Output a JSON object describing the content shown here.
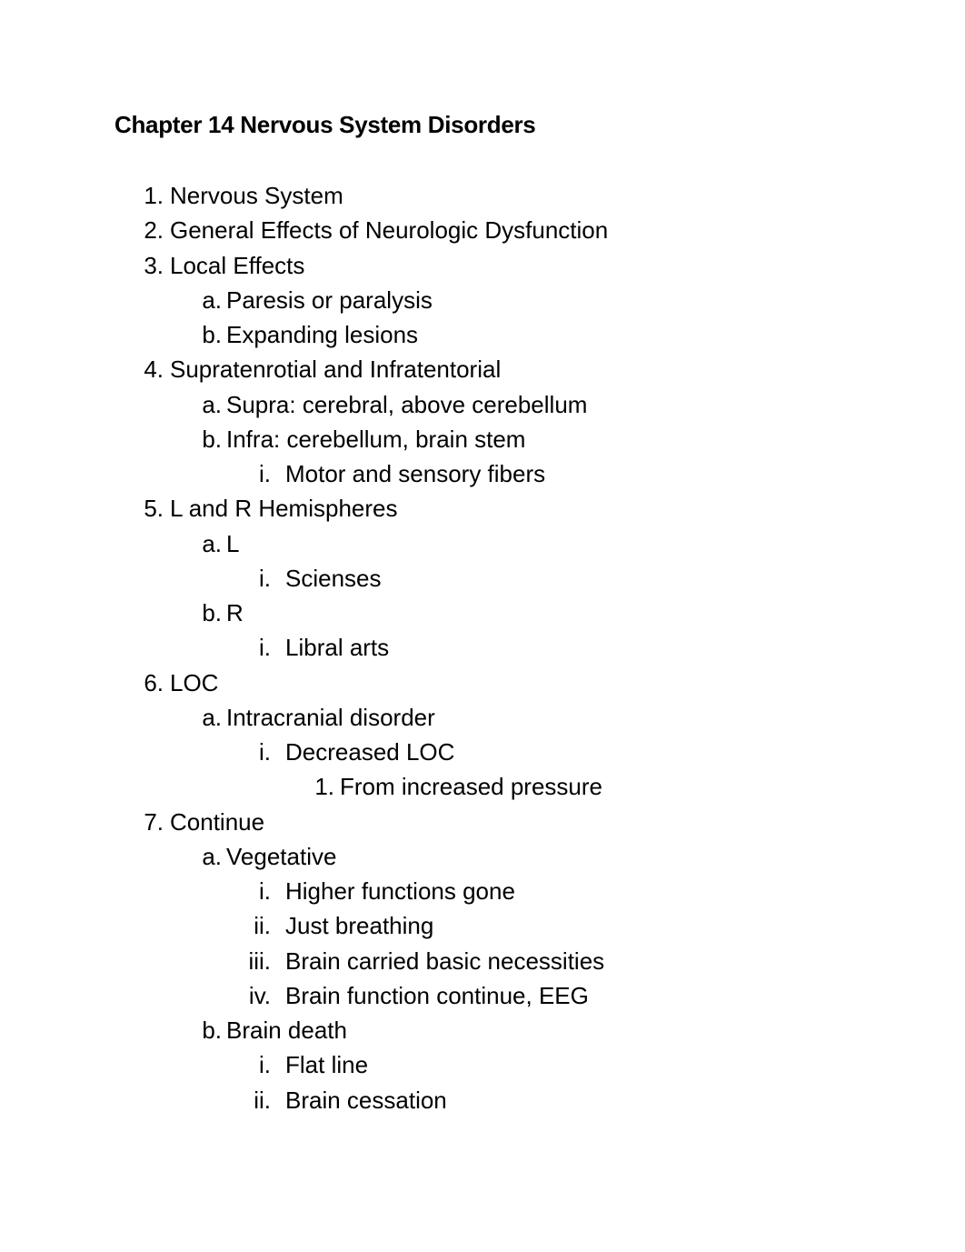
{
  "document": {
    "title": "Chapter 14 Nervous System Disorders",
    "outline": [
      {
        "level": 1,
        "marker": "1.",
        "text": "Nervous System"
      },
      {
        "level": 1,
        "marker": "2.",
        "text": "General Effects of Neurologic Dysfunction"
      },
      {
        "level": 1,
        "marker": "3.",
        "text": "Local Effects"
      },
      {
        "level": 2,
        "marker": "a.",
        "text": "Paresis or paralysis"
      },
      {
        "level": 2,
        "marker": "b.",
        "text": "Expanding lesions"
      },
      {
        "level": 1,
        "marker": "4.",
        "text": "Supratenrotial and Infratentorial"
      },
      {
        "level": 2,
        "marker": "a.",
        "text": "Supra: cerebral, above cerebellum"
      },
      {
        "level": 2,
        "marker": "b.",
        "text": "Infra: cerebellum, brain stem"
      },
      {
        "level": 3,
        "marker": "i.",
        "text": "Motor and sensory fibers"
      },
      {
        "level": 1,
        "marker": "5.",
        "text": "L and R Hemispheres"
      },
      {
        "level": 2,
        "marker": "a.",
        "text": "L"
      },
      {
        "level": 3,
        "marker": "i.",
        "text": "Sciense s"
      },
      {
        "level": 2,
        "marker": "b.",
        "text": "R"
      },
      {
        "level": 3,
        "marker": "i.",
        "text": "Libral arts"
      },
      {
        "level": 1,
        "marker": "6.",
        "text": "LOC"
      },
      {
        "level": 2,
        "marker": "a.",
        "text": "Intracranial disorder"
      },
      {
        "level": 3,
        "marker": "i.",
        "text": "Decreased LOC"
      },
      {
        "level": 4,
        "marker": "1.",
        "text": "From increased pressure"
      },
      {
        "level": 1,
        "marker": "7.",
        "text": "Continue"
      },
      {
        "level": 2,
        "marker": "a.",
        "text": "Vegetative"
      },
      {
        "level": 3,
        "marker": "i.",
        "text": "Higher functions gone"
      },
      {
        "level": 3,
        "marker": "ii.",
        "text": "Just breathing"
      },
      {
        "level": 3,
        "marker": "iii.",
        "text": "Brain carried basic necessities"
      },
      {
        "level": 3,
        "marker": "iv.",
        "text": "Brain function continue, EEG"
      },
      {
        "level": 2,
        "marker": "b.",
        "text": "Brain death"
      },
      {
        "level": 3,
        "marker": "i.",
        "text": "Flat line"
      },
      {
        "level": 3,
        "marker": "ii.",
        "text": "Brain cessation"
      }
    ]
  }
}
